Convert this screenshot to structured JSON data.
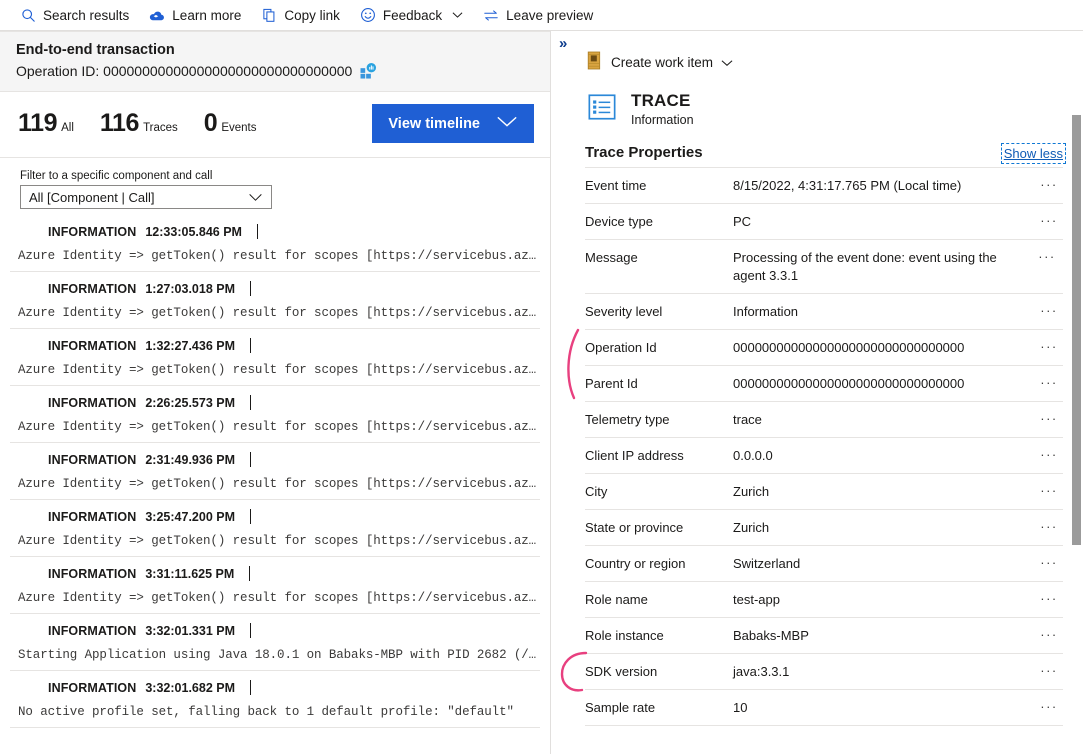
{
  "commandbar": {
    "items": [
      {
        "label": "Search results",
        "icon": "search-icon"
      },
      {
        "label": "Learn more",
        "icon": "cloud-learn-icon"
      },
      {
        "label": "Copy link",
        "icon": "copy-icon"
      },
      {
        "label": "Feedback",
        "icon": "smiley-icon",
        "chevron": "∨"
      },
      {
        "label": "Leave preview",
        "icon": "swap-arrows-icon"
      }
    ]
  },
  "left": {
    "header": {
      "title": "End-to-end transaction",
      "operation_label": "Operation ID: 00000000000000000000000000000000",
      "pin_icon": "pin-to-dashboard-icon"
    },
    "stats": [
      {
        "count": "119",
        "label": "All"
      },
      {
        "count": "116",
        "label": "Traces"
      },
      {
        "count": "0",
        "label": "Events"
      }
    ],
    "view_timeline_button": "View timeline",
    "view_timeline_chevron": "∨",
    "filter": {
      "label": "Filter to a specific component and call",
      "selected": "All [Component | Call]",
      "chevron": "∨"
    },
    "logs": [
      {
        "severity": "INFORMATION",
        "time": "12:33:05.846 PM",
        "message": "Azure Identity => getToken() result for scopes [https://servicebus.az…"
      },
      {
        "severity": "INFORMATION",
        "time": "1:27:03.018 PM",
        "message": "Azure Identity => getToken() result for scopes [https://servicebus.az…"
      },
      {
        "severity": "INFORMATION",
        "time": "1:32:27.436 PM",
        "message": "Azure Identity => getToken() result for scopes [https://servicebus.az…"
      },
      {
        "severity": "INFORMATION",
        "time": "2:26:25.573 PM",
        "message": "Azure Identity => getToken() result for scopes [https://servicebus.az…"
      },
      {
        "severity": "INFORMATION",
        "time": "2:31:49.936 PM",
        "message": "Azure Identity => getToken() result for scopes [https://servicebus.az…"
      },
      {
        "severity": "INFORMATION",
        "time": "3:25:47.200 PM",
        "message": "Azure Identity => getToken() result for scopes [https://servicebus.az…"
      },
      {
        "severity": "INFORMATION",
        "time": "3:31:11.625 PM",
        "message": "Azure Identity => getToken() result for scopes [https://servicebus.az…"
      },
      {
        "severity": "INFORMATION",
        "time": "3:32:01.331 PM",
        "message": "Starting Application using Java 18.0.1 on Babaks-MBP with PID 2682 (/…"
      },
      {
        "severity": "INFORMATION",
        "time": "3:32:01.682 PM",
        "message": "No active profile set, falling back to 1 default profile: \"default\""
      }
    ]
  },
  "right": {
    "collapse_glyph": "»",
    "create_work_item": {
      "label": "Create work item",
      "chevron": "∨",
      "icon": "work-item-book-icon"
    },
    "hero": {
      "type": "TRACE",
      "subtitle": "Information",
      "icon": "trace-list-icon"
    },
    "properties_title": "Trace Properties",
    "show_less": "Show less",
    "dots_label": "···",
    "properties": [
      {
        "key": "Event time",
        "value": "8/15/2022, 4:31:17.765 PM (Local time)"
      },
      {
        "key": "Device type",
        "value": "PC"
      },
      {
        "key": "Message",
        "value": "Processing of the event done: event using the agent 3.3.1"
      },
      {
        "key": "Severity level",
        "value": "Information"
      },
      {
        "key": "Operation Id",
        "value": "00000000000000000000000000000000"
      },
      {
        "key": "Parent Id",
        "value": "00000000000000000000000000000000"
      },
      {
        "key": "Telemetry type",
        "value": "trace"
      },
      {
        "key": "Client IP address",
        "value": "0.0.0.0"
      },
      {
        "key": "City",
        "value": "Zurich"
      },
      {
        "key": "State or province",
        "value": "Zurich"
      },
      {
        "key": "Country or region",
        "value": "Switzerland"
      },
      {
        "key": "Role name",
        "value": "test-app"
      },
      {
        "key": "Role instance",
        "value": "Babaks-MBP"
      },
      {
        "key": "SDK version",
        "value": "java:3.3.1"
      },
      {
        "key": "Sample rate",
        "value": "10"
      }
    ]
  },
  "colors": {
    "accent_blue": "#1f5fd4",
    "link_blue": "#0f5bb5",
    "icon_blue": "#1b6ec2",
    "annotation_pink": "#e8407f",
    "divider": "#e6e4e2"
  }
}
